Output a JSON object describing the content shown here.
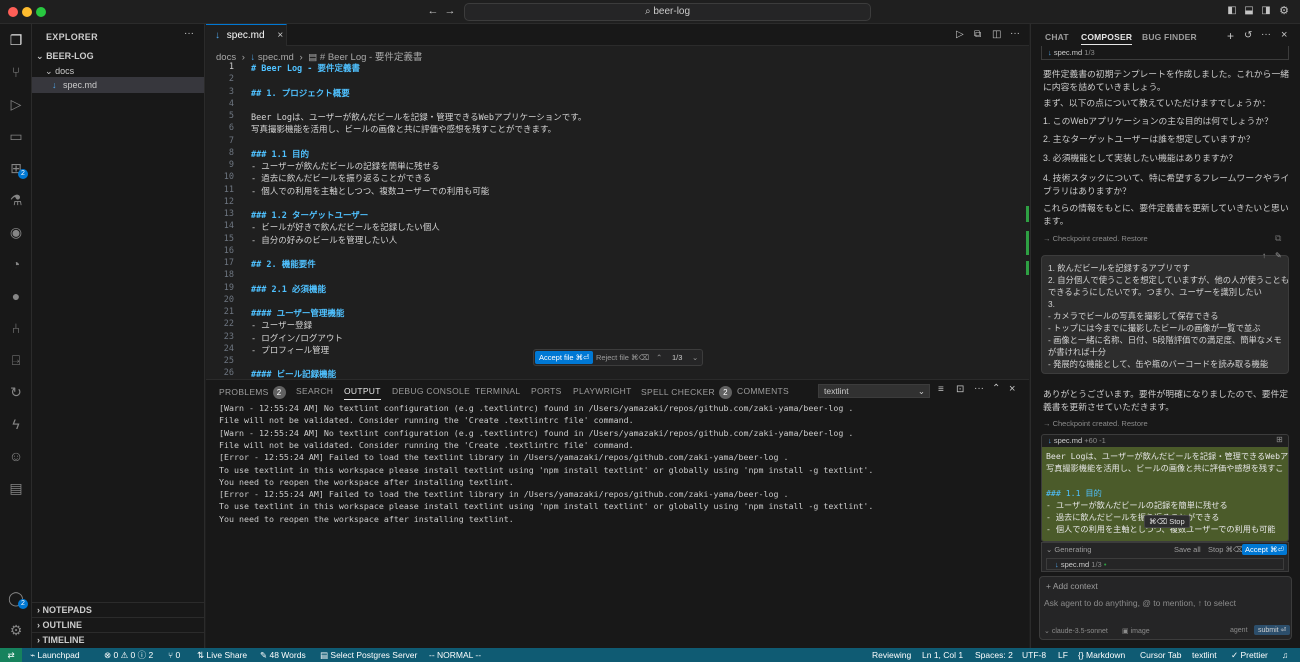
{
  "titlebar": {
    "search": "beer-log",
    "search_icon": "search-icon"
  },
  "activity": {
    "extensions_badge": "2",
    "accounts_badge": "2"
  },
  "explorer": {
    "title": "EXPLORER",
    "more": "···",
    "root": "BEER-LOG",
    "folder": "docs",
    "file": "spec.md",
    "sections": [
      "NOTEPADS",
      "OUTLINE",
      "TIMELINE"
    ]
  },
  "editor": {
    "tab": "spec.md",
    "breadcrumb": [
      "docs",
      "spec.md",
      "# Beer Log - 要件定義書"
    ],
    "lines": [
      {
        "n": "1",
        "t": "# Beer Log - 要件定義書",
        "k": "h"
      },
      {
        "n": "2",
        "t": "",
        "k": "li"
      },
      {
        "n": "3",
        "t": "## 1. プロジェクト概要",
        "k": "h"
      },
      {
        "n": "4",
        "t": "",
        "k": "li"
      },
      {
        "n": "5",
        "t": "Beer Logは、ユーザーが飲んだビールを記録・管理できるWebアプリケーションです。",
        "k": "li"
      },
      {
        "n": "6",
        "t": "写真撮影機能を活用し、ビールの画像と共に評価や感想を残すことができます。",
        "k": "li"
      },
      {
        "n": "7",
        "t": "",
        "k": "li"
      },
      {
        "n": "8",
        "t": "### 1.1 目的",
        "k": "h"
      },
      {
        "n": "9",
        "t": "- ユーザーが飲んだビールの記録を簡単に残せる",
        "k": "li"
      },
      {
        "n": "10",
        "t": "- 過去に飲んだビールを振り返ることができる",
        "k": "li"
      },
      {
        "n": "11",
        "t": "- 個人での利用を主軸としつつ、複数ユーザーでの利用も可能",
        "k": "li"
      },
      {
        "n": "12",
        "t": "",
        "k": "li"
      },
      {
        "n": "13",
        "t": "### 1.2 ターゲットユーザー",
        "k": "h"
      },
      {
        "n": "14",
        "t": "- ビールが好きで飲んだビールを記録したい個人",
        "k": "li"
      },
      {
        "n": "15",
        "t": "- 自分の好みのビールを管理したい人",
        "k": "li"
      },
      {
        "n": "16",
        "t": "",
        "k": "li"
      },
      {
        "n": "17",
        "t": "## 2. 機能要件",
        "k": "h"
      },
      {
        "n": "18",
        "t": "",
        "k": "li"
      },
      {
        "n": "19",
        "t": "### 2.1 必須機能",
        "k": "h"
      },
      {
        "n": "20",
        "t": "",
        "k": "li"
      },
      {
        "n": "21",
        "t": "#### ユーザー管理機能",
        "k": "h"
      },
      {
        "n": "22",
        "t": "- ユーザー登録",
        "k": "li"
      },
      {
        "n": "23",
        "t": "- ログイン/ログアウト",
        "k": "li"
      },
      {
        "n": "24",
        "t": "- プロフィール管理",
        "k": "li"
      },
      {
        "n": "25",
        "t": "",
        "k": "li"
      },
      {
        "n": "26",
        "t": "#### ビール記録機能",
        "k": "h"
      }
    ],
    "inline": {
      "accept": "Accept file ⌘⏎",
      "reject": "Reject file ⌘⌫",
      "count": "1/3"
    }
  },
  "panel": {
    "tabs": [
      {
        "label": "PROBLEMS",
        "badge": "2"
      },
      {
        "label": "SEARCH",
        "badge": ""
      },
      {
        "label": "OUTPUT",
        "badge": ""
      },
      {
        "label": "DEBUG CONSOLE",
        "badge": ""
      },
      {
        "label": "TERMINAL",
        "badge": ""
      },
      {
        "label": "PORTS",
        "badge": ""
      },
      {
        "label": "PLAYWRIGHT",
        "badge": ""
      },
      {
        "label": "SPELL CHECKER",
        "badge": "2"
      },
      {
        "label": "COMMENTS",
        "badge": ""
      }
    ],
    "output_channel": "textlint",
    "output": [
      "[Warn  - 12:55:24 AM] No textlint configuration (e.g .textlintrc) found in /Users/yamazaki/repos/github.com/zaki-yama/beer-log .",
      "File will not be validated. Consider running the 'Create .textlintrc file' command.",
      "[Warn  - 12:55:24 AM] No textlint configuration (e.g .textlintrc) found in /Users/yamazaki/repos/github.com/zaki-yama/beer-log .",
      "File will not be validated. Consider running the 'Create .textlintrc file' command.",
      "[Error - 12:55:24 AM] Failed to load the textlint library in /Users/yamazaki/repos/github.com/zaki-yama/beer-log .",
      "To use textlint in this workspace please install textlint using 'npm install textlint' or globally using 'npm install -g textlint'.",
      "You need to reopen the workspace after installing textlint.",
      "[Error - 12:55:24 AM] Failed to load the textlint library in /Users/yamazaki/repos/github.com/zaki-yama/beer-log .",
      "To use textlint in this workspace please install textlint using 'npm install textlint' or globally using 'npm install -g textlint'.",
      "You need to reopen the workspace after installing textlint."
    ]
  },
  "chat": {
    "tabs": [
      "CHAT",
      "COMPOSER",
      "BUG FINDER"
    ],
    "ref_file": "spec.md",
    "ref_count": "1/3",
    "para1": "要件定義書の初期テンプレートを作成しました。これから一緒に内容を詰めていきましょう。",
    "para2": "まず、以下の点について教えていただけますでしょうか：",
    "q1": "1. このWebアプリケーションの主な目的は何でしょうか？",
    "q2": "2. 主なターゲットユーザーは誰を想定していますか？",
    "q3": "3. 必須機能として実装したい機能はありますか？",
    "q4": "4. 技術スタックについて、特に希望するフレームワークやライブラリはありますか？",
    "para3": "これらの情報をもとに、要件定義書を更新していきたいと思います。",
    "checkpoint": "Checkpoint created.",
    "restore": "Restore",
    "user_lines": [
      "1. 飲んだビールを記録するアプリです",
      "2. 自分個人で使うことを想定していますが、他の人が使うことも",
      "できるようにしたいです。つまり、ユーザーを識別したい",
      "3.",
      "- カメラでビールの写真を撮影して保存できる",
      "- トップには今までに撮影したビールの画像が一覧で並ぶ",
      "- 画像と一緒に名称、日付、5段階評価での満足度、簡単なメモ",
      "が書ければ十分",
      "- 発展的な機能として、缶や瓶のバーコードを読み取る機能"
    ],
    "para4": "ありがとうございます。要件が明確になりましたので、要件定義書を更新させていただきます。",
    "diff_file": "spec.md",
    "diff_stats": "+60 -1",
    "diff_lines": [
      "Beer Logは、ユーザーが飲んだビールを記録・管理できるWebアプ",
      "写真撮影機能を活用し、ビールの画像と共に評価や感想を残すこ",
      "",
      "### 1.1 目的",
      "- ユーザーが飲んだビールの記録を簡単に残せる",
      "- 過去に飲んだビールを振り返ることができる",
      "- 個人での利用を主軸としつつ、複数ユーザーでの利用も可能"
    ],
    "stop_tooltip": "⌘⌫ Stop",
    "generating": "Generating",
    "save_all": "Save all",
    "stop": "Stop ⌘⌫",
    "accept": "Accept ⌘⏎",
    "gen_file": "spec.md",
    "gen_count": "1/3",
    "add_context": "+ Add context",
    "placeholder": "Ask agent to do anything, @ to mention, ↑ to select",
    "model": "claude-3.5-sonnet",
    "image": "image",
    "mode": "agent",
    "submit": "submit ⏎"
  },
  "status": {
    "launchpad": "Launchpad",
    "problems": "⊗ 0 ⚠ 0 ⓘ 2",
    "ports": "⑂ 0",
    "liveshare": "Live Share",
    "words": "48 Words",
    "postgres": "Select Postgres Server",
    "vim": "-- NORMAL --",
    "reviewing": "Reviewing",
    "position": "Ln 1, Col 1",
    "spaces": "Spaces: 2",
    "encoding": "UTF-8",
    "eol": "LF",
    "lang": "Markdown",
    "cursortab": "Cursor Tab",
    "lint": "textlint",
    "prettier": "✓ Prettier"
  }
}
